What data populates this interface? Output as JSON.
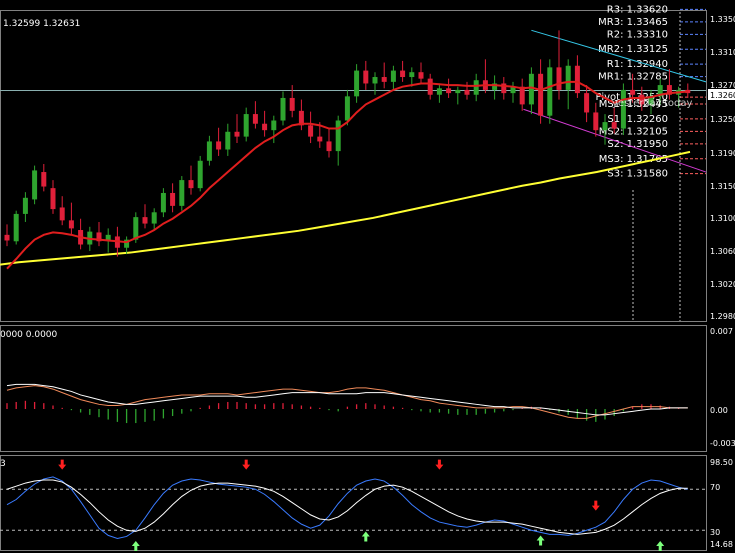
{
  "header": {
    "bid_ask": "1.32599 1.32631"
  },
  "price_axis": {
    "ticks": [
      "1.3350",
      "1.3310",
      "1.3270",
      "1.3250",
      "1.3190",
      "1.3150",
      "1.3100",
      "1.3060",
      "1.3020",
      "1.2980"
    ],
    "current_price_label": "1.3260"
  },
  "pivot_levels": [
    {
      "name": "R3",
      "value": "1.33620"
    },
    {
      "name": "MR3",
      "value": "1.33465"
    },
    {
      "name": "R2",
      "value": "1.33310"
    },
    {
      "name": "MR2",
      "value": "1.33125"
    },
    {
      "name": "R1",
      "value": "1.32940"
    },
    {
      "name": "MR1",
      "value": "1.32785"
    },
    {
      "name": "Pivot",
      "value": "1.32530"
    },
    {
      "name": "MS1",
      "value": "1.32445"
    },
    {
      "name": "S1",
      "value": "1.32260"
    },
    {
      "name": "MS2",
      "value": "1.32105"
    },
    {
      "name": "S2",
      "value": "1.31950"
    },
    {
      "name": "MS3",
      "value": "1.31765"
    },
    {
      "name": "S3",
      "value": "1.31580"
    }
  ],
  "session_labels": [
    "yesterday",
    "today"
  ],
  "macd": {
    "header": "0000 0.0000",
    "ticks": [
      "0.007",
      "0.00",
      "-0.003"
    ]
  },
  "oscillator": {
    "header": "3",
    "ticks": [
      "98.50",
      "70",
      "30",
      "14.68"
    ]
  },
  "colors": {
    "background": "#000000",
    "bull_candle": "#2fa52f",
    "bear_candle": "#e0203a",
    "ma_fast": "#e01e1e",
    "ma_slow": "#ffff33",
    "channel_top": "#35c8e8",
    "channel_bottom": "#d23bd2",
    "macd_signal": "#ffffff",
    "macd_main": "#f08a5a",
    "osc_main": "#3a7bff",
    "osc_signal": "#ffffff",
    "arrow_down": "#ff2020",
    "arrow_up": "#7cff7c"
  },
  "chart_data": {
    "type": "candlestick",
    "price_range": [
      1.2975,
      1.336
    ],
    "candles": [
      [
        1.3082,
        1.3095,
        1.3068,
        1.3075
      ],
      [
        1.3074,
        1.3112,
        1.307,
        1.3108
      ],
      [
        1.3108,
        1.3135,
        1.3098,
        1.3128
      ],
      [
        1.3126,
        1.3168,
        1.312,
        1.3162
      ],
      [
        1.316,
        1.317,
        1.3136,
        1.3142
      ],
      [
        1.314,
        1.315,
        1.3108,
        1.3114
      ],
      [
        1.3116,
        1.313,
        1.3094,
        1.31
      ],
      [
        1.31,
        1.3122,
        1.3082,
        1.309
      ],
      [
        1.3088,
        1.3102,
        1.3064,
        1.307
      ],
      [
        1.307,
        1.3092,
        1.3062,
        1.3086
      ],
      [
        1.3085,
        1.3098,
        1.3068,
        1.3074
      ],
      [
        1.3075,
        1.309,
        1.306,
        1.3082
      ],
      [
        1.308,
        1.3092,
        1.3055,
        1.3066
      ],
      [
        1.3066,
        1.308,
        1.3058,
        1.3076
      ],
      [
        1.3076,
        1.311,
        1.3072,
        1.3104
      ],
      [
        1.3104,
        1.312,
        1.309,
        1.3096
      ],
      [
        1.3096,
        1.3115,
        1.3088,
        1.311
      ],
      [
        1.311,
        1.314,
        1.3104,
        1.3134
      ],
      [
        1.3134,
        1.3146,
        1.311,
        1.3118
      ],
      [
        1.3118,
        1.3155,
        1.3112,
        1.315
      ],
      [
        1.315,
        1.3168,
        1.3132,
        1.314
      ],
      [
        1.314,
        1.318,
        1.3136,
        1.3174
      ],
      [
        1.3174,
        1.3205,
        1.3168,
        1.3198
      ],
      [
        1.3198,
        1.3215,
        1.318,
        1.3188
      ],
      [
        1.3188,
        1.322,
        1.318,
        1.321
      ],
      [
        1.321,
        1.3232,
        1.3196,
        1.3204
      ],
      [
        1.3204,
        1.324,
        1.3198,
        1.3232
      ],
      [
        1.3232,
        1.3248,
        1.3214,
        1.322
      ],
      [
        1.322,
        1.3236,
        1.3204,
        1.3212
      ],
      [
        1.3212,
        1.323,
        1.3196,
        1.3224
      ],
      [
        1.3224,
        1.326,
        1.3218,
        1.3252
      ],
      [
        1.3252,
        1.3268,
        1.3228,
        1.3236
      ],
      [
        1.3236,
        1.325,
        1.3212,
        1.3218
      ],
      [
        1.3218,
        1.3235,
        1.3196,
        1.3204
      ],
      [
        1.3204,
        1.3222,
        1.319,
        1.3198
      ],
      [
        1.3198,
        1.3214,
        1.3178,
        1.3186
      ],
      [
        1.3186,
        1.323,
        1.3168,
        1.3224
      ],
      [
        1.3224,
        1.3262,
        1.3218,
        1.3254
      ],
      [
        1.3254,
        1.3294,
        1.3246,
        1.3286
      ],
      [
        1.3286,
        1.3298,
        1.3262,
        1.327
      ],
      [
        1.327,
        1.3284,
        1.3256,
        1.3278
      ],
      [
        1.3278,
        1.3296,
        1.3264,
        1.3272
      ],
      [
        1.3272,
        1.3292,
        1.3262,
        1.3286
      ],
      [
        1.3286,
        1.3298,
        1.3272,
        1.3278
      ],
      [
        1.3278,
        1.329,
        1.3266,
        1.3284
      ],
      [
        1.3284,
        1.3296,
        1.327,
        1.3276
      ],
      [
        1.3276,
        1.3282,
        1.325,
        1.3256
      ],
      [
        1.3256,
        1.327,
        1.3246,
        1.3264
      ],
      [
        1.3264,
        1.3276,
        1.3252,
        1.3258
      ],
      [
        1.3258,
        1.3266,
        1.3244,
        1.3262
      ],
      [
        1.3262,
        1.3272,
        1.325,
        1.3256
      ],
      [
        1.3256,
        1.3282,
        1.3248,
        1.3274
      ],
      [
        1.3274,
        1.33,
        1.3258,
        1.3262
      ],
      [
        1.3262,
        1.328,
        1.325,
        1.327
      ],
      [
        1.327,
        1.3278,
        1.325,
        1.3258
      ],
      [
        1.3258,
        1.3272,
        1.3246,
        1.3266
      ],
      [
        1.3266,
        1.3276,
        1.3236,
        1.3244
      ],
      [
        1.3244,
        1.329,
        1.3232,
        1.3282
      ],
      [
        1.3282,
        1.33,
        1.322,
        1.323
      ],
      [
        1.323,
        1.33,
        1.322,
        1.329
      ],
      [
        1.329,
        1.3336,
        1.325,
        1.3262
      ],
      [
        1.3262,
        1.33,
        1.3238,
        1.3292
      ],
      [
        1.3292,
        1.3305,
        1.3252,
        1.3258
      ],
      [
        1.3258,
        1.3268,
        1.3222,
        1.3234
      ],
      [
        1.3234,
        1.3246,
        1.3204,
        1.3212
      ],
      [
        1.3212,
        1.3232,
        1.3194,
        1.3222
      ],
      [
        1.3222,
        1.324,
        1.3208,
        1.3214
      ],
      [
        1.3214,
        1.327,
        1.3206,
        1.3262
      ],
      [
        1.3262,
        1.3282,
        1.3246,
        1.3256
      ],
      [
        1.3256,
        1.3266,
        1.3236,
        1.3244
      ],
      [
        1.3244,
        1.3262,
        1.3232,
        1.3254
      ],
      [
        1.3254,
        1.3276,
        1.3244,
        1.3268
      ],
      [
        1.3268,
        1.3288,
        1.325,
        1.3256
      ],
      [
        1.3256,
        1.3266,
        1.324,
        1.3262
      ],
      [
        1.3262,
        1.327,
        1.3252,
        1.3258
      ]
    ],
    "ma_fast": [
      1.304,
      1.3052,
      1.3065,
      1.3076,
      1.3082,
      1.3085,
      1.3084,
      1.3082,
      1.3079,
      1.3077,
      1.3076,
      1.3075,
      1.3074,
      1.3073,
      1.3078,
      1.3082,
      1.3088,
      1.3096,
      1.3102,
      1.311,
      1.3118,
      1.3128,
      1.314,
      1.315,
      1.316,
      1.317,
      1.318,
      1.319,
      1.3198,
      1.3204,
      1.3212,
      1.3218,
      1.322,
      1.322,
      1.3218,
      1.3214,
      1.3214,
      1.3222,
      1.3234,
      1.3244,
      1.325,
      1.3256,
      1.3262,
      1.3266,
      1.3268,
      1.327,
      1.327,
      1.3269,
      1.3268,
      1.3268,
      1.3267,
      1.3267,
      1.3268,
      1.3268,
      1.3267,
      1.3266,
      1.3264,
      1.3265,
      1.3262,
      1.3266,
      1.327,
      1.3272,
      1.3272,
      1.3266,
      1.3258,
      1.3252,
      1.3246,
      1.325,
      1.3252,
      1.3252,
      1.3253,
      1.3256,
      1.3258,
      1.3259,
      1.326
    ],
    "ma_slow": [
      1.3045,
      1.3048,
      1.305,
      1.3052,
      1.3054,
      1.3056,
      1.3058,
      1.306,
      1.3063,
      1.3066,
      1.3069,
      1.3072,
      1.3075,
      1.3078,
      1.3081,
      1.3084,
      1.3087,
      1.3091,
      1.3095,
      1.3099,
      1.3103,
      1.3108,
      1.3113,
      1.3118,
      1.3123,
      1.3128,
      1.3133,
      1.3138,
      1.3143,
      1.3147,
      1.3152,
      1.3156,
      1.316,
      1.3165,
      1.317,
      1.3175,
      1.318,
      1.3185
    ],
    "channel_top": [
      1.3336,
      1.3272
    ],
    "channel_bottom": [
      1.3238,
      1.316
    ],
    "macd_hist": [
      0.0005,
      0.0006,
      0.0007,
      0.0006,
      0.0005,
      0.0003,
      0.0001,
      -0.0001,
      -0.0003,
      -0.0005,
      -0.0007,
      -0.0009,
      -0.0011,
      -0.0012,
      -0.0012,
      -0.0011,
      -0.001,
      -0.0008,
      -0.0006,
      -0.0004,
      -0.0002,
      0.0001,
      0.0003,
      0.0005,
      0.0006,
      0.0006,
      0.0005,
      0.0004,
      0.0004,
      0.0005,
      0.0005,
      0.0004,
      0.0003,
      0.0002,
      0.0001,
      -0.0001,
      -0.0002,
      0.0002,
      0.0004,
      0.0005,
      0.0004,
      0.0003,
      0.0002,
      0.0001,
      -0.0001,
      -0.0002,
      -0.0003,
      -0.0003,
      -0.0004,
      -0.0005,
      -0.0005,
      -0.0005,
      -0.0004,
      -0.0003,
      -0.0002,
      -0.0001,
      0.0001,
      0.0002,
      0.0001,
      -0.0001,
      -0.0003,
      -0.0005,
      -0.0008,
      -0.001,
      -0.0011,
      -0.0009,
      -0.0006,
      -0.0002,
      0.0002,
      0.0004,
      0.0004,
      0.0003,
      0.0002,
      0.0001,
      0.0
    ],
    "macd_signal": [
      0.002,
      0.0021,
      0.0021,
      0.0021,
      0.002,
      0.0019,
      0.0017,
      0.0015,
      0.0012,
      0.001,
      0.0008,
      0.0006,
      0.0005,
      0.0004,
      0.0004,
      0.0005,
      0.0006,
      0.0007,
      0.0008,
      0.0009,
      0.001,
      0.0011,
      0.0011,
      0.0011,
      0.0011,
      0.0011,
      0.001,
      0.001,
      0.0011,
      0.0012,
      0.0013,
      0.0014,
      0.0014,
      0.0014,
      0.0014,
      0.0013,
      0.0013,
      0.0013,
      0.0013,
      0.0014,
      0.0014,
      0.0014,
      0.0013,
      0.0012,
      0.0011,
      0.001,
      0.0009,
      0.0008,
      0.0007,
      0.0006,
      0.0005,
      0.0004,
      0.0003,
      0.0002,
      0.0002,
      0.0001,
      0.0001,
      0.0001,
      0.0001,
      0.0,
      -0.0001,
      -0.0002,
      -0.0003,
      -0.0004,
      -0.0005,
      -0.0005,
      -0.0004,
      -0.0003,
      -0.0002,
      -0.0001,
      -0.0,
      0.0,
      0.0001,
      0.0001,
      0.0001
    ],
    "macd_main": [
      0.0016,
      0.0018,
      0.0019,
      0.002,
      0.0019,
      0.0017,
      0.0014,
      0.0011,
      0.0008,
      0.0006,
      0.0004,
      0.0003,
      0.0003,
      0.0004,
      0.0006,
      0.0008,
      0.0009,
      0.001,
      0.0011,
      0.0012,
      0.0012,
      0.0012,
      0.0013,
      0.0013,
      0.0013,
      0.0012,
      0.0013,
      0.0014,
      0.0015,
      0.0016,
      0.0017,
      0.0017,
      0.0016,
      0.0015,
      0.0014,
      0.0014,
      0.0015,
      0.0017,
      0.0018,
      0.0018,
      0.0017,
      0.0016,
      0.0014,
      0.0012,
      0.001,
      0.0008,
      0.0007,
      0.0005,
      0.0004,
      0.0003,
      0.0002,
      0.0001,
      0.0001,
      0.0001,
      0.0001,
      0.0002,
      0.0002,
      0.0001,
      -0.0001,
      -0.0003,
      -0.0005,
      -0.0007,
      -0.0008,
      -0.0008,
      -0.0006,
      -0.0004,
      -0.0002,
      0.0,
      0.0002,
      0.0002,
      0.0002,
      0.0002,
      0.0001,
      0.0001,
      0.0001
    ],
    "osc_main": [
      55,
      60,
      68,
      75,
      80,
      82,
      78,
      70,
      58,
      45,
      32,
      25,
      22,
      24,
      30,
      42,
      55,
      66,
      74,
      78,
      80,
      79,
      77,
      75,
      74,
      73,
      72,
      70,
      65,
      58,
      50,
      42,
      36,
      32,
      35,
      44,
      56,
      66,
      74,
      78,
      80,
      78,
      72,
      64,
      55,
      48,
      42,
      38,
      36,
      34,
      33,
      35,
      38,
      40,
      39,
      36,
      33,
      30,
      28,
      26,
      26,
      25,
      27,
      30,
      33,
      38,
      48,
      60,
      70,
      76,
      79,
      78,
      75,
      72,
      70
    ],
    "osc_signal": [
      70,
      73,
      76,
      78,
      79,
      79,
      77,
      72,
      65,
      57,
      48,
      40,
      34,
      30,
      29,
      32,
      38,
      46,
      55,
      63,
      69,
      73,
      75,
      76,
      76,
      75,
      74,
      73,
      71,
      68,
      63,
      57,
      51,
      45,
      41,
      40,
      43,
      49,
      57,
      64,
      70,
      73,
      74,
      72,
      68,
      63,
      58,
      53,
      48,
      44,
      41,
      39,
      38,
      38,
      38,
      37,
      36,
      34,
      32,
      30,
      28,
      27,
      26,
      27,
      28,
      31,
      35,
      41,
      48,
      55,
      61,
      66,
      69,
      71,
      71
    ],
    "arrows_down": [
      {
        "bar": 6,
        "value": 94
      },
      {
        "bar": 26,
        "value": 94
      },
      {
        "bar": 47,
        "value": 94
      },
      {
        "bar": 64,
        "value": 54
      }
    ],
    "arrows_up": [
      {
        "bar": 14,
        "value": 14.68
      },
      {
        "bar": 39,
        "value": 24
      },
      {
        "bar": 58,
        "value": 20
      },
      {
        "bar": 71,
        "value": 14.68
      }
    ],
    "macd_range": [
      -0.0035,
      0.007
    ],
    "osc_range": [
      14.68,
      98.5
    ]
  }
}
